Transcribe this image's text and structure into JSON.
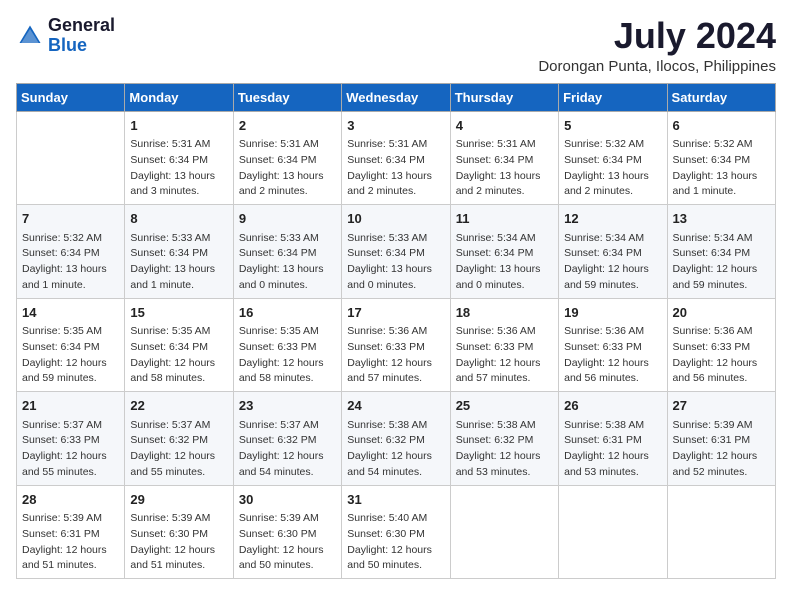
{
  "logo": {
    "general": "General",
    "blue": "Blue"
  },
  "title": {
    "month_year": "July 2024",
    "location": "Dorongan Punta, Ilocos, Philippines"
  },
  "headers": [
    "Sunday",
    "Monday",
    "Tuesday",
    "Wednesday",
    "Thursday",
    "Friday",
    "Saturday"
  ],
  "weeks": [
    [
      {
        "day": "",
        "info": ""
      },
      {
        "day": "1",
        "info": "Sunrise: 5:31 AM\nSunset: 6:34 PM\nDaylight: 13 hours\nand 3 minutes."
      },
      {
        "day": "2",
        "info": "Sunrise: 5:31 AM\nSunset: 6:34 PM\nDaylight: 13 hours\nand 2 minutes."
      },
      {
        "day": "3",
        "info": "Sunrise: 5:31 AM\nSunset: 6:34 PM\nDaylight: 13 hours\nand 2 minutes."
      },
      {
        "day": "4",
        "info": "Sunrise: 5:31 AM\nSunset: 6:34 PM\nDaylight: 13 hours\nand 2 minutes."
      },
      {
        "day": "5",
        "info": "Sunrise: 5:32 AM\nSunset: 6:34 PM\nDaylight: 13 hours\nand 2 minutes."
      },
      {
        "day": "6",
        "info": "Sunrise: 5:32 AM\nSunset: 6:34 PM\nDaylight: 13 hours\nand 1 minute."
      }
    ],
    [
      {
        "day": "7",
        "info": "Sunrise: 5:32 AM\nSunset: 6:34 PM\nDaylight: 13 hours\nand 1 minute."
      },
      {
        "day": "8",
        "info": "Sunrise: 5:33 AM\nSunset: 6:34 PM\nDaylight: 13 hours\nand 1 minute."
      },
      {
        "day": "9",
        "info": "Sunrise: 5:33 AM\nSunset: 6:34 PM\nDaylight: 13 hours\nand 0 minutes."
      },
      {
        "day": "10",
        "info": "Sunrise: 5:33 AM\nSunset: 6:34 PM\nDaylight: 13 hours\nand 0 minutes."
      },
      {
        "day": "11",
        "info": "Sunrise: 5:34 AM\nSunset: 6:34 PM\nDaylight: 13 hours\nand 0 minutes."
      },
      {
        "day": "12",
        "info": "Sunrise: 5:34 AM\nSunset: 6:34 PM\nDaylight: 12 hours\nand 59 minutes."
      },
      {
        "day": "13",
        "info": "Sunrise: 5:34 AM\nSunset: 6:34 PM\nDaylight: 12 hours\nand 59 minutes."
      }
    ],
    [
      {
        "day": "14",
        "info": "Sunrise: 5:35 AM\nSunset: 6:34 PM\nDaylight: 12 hours\nand 59 minutes."
      },
      {
        "day": "15",
        "info": "Sunrise: 5:35 AM\nSunset: 6:34 PM\nDaylight: 12 hours\nand 58 minutes."
      },
      {
        "day": "16",
        "info": "Sunrise: 5:35 AM\nSunset: 6:33 PM\nDaylight: 12 hours\nand 58 minutes."
      },
      {
        "day": "17",
        "info": "Sunrise: 5:36 AM\nSunset: 6:33 PM\nDaylight: 12 hours\nand 57 minutes."
      },
      {
        "day": "18",
        "info": "Sunrise: 5:36 AM\nSunset: 6:33 PM\nDaylight: 12 hours\nand 57 minutes."
      },
      {
        "day": "19",
        "info": "Sunrise: 5:36 AM\nSunset: 6:33 PM\nDaylight: 12 hours\nand 56 minutes."
      },
      {
        "day": "20",
        "info": "Sunrise: 5:36 AM\nSunset: 6:33 PM\nDaylight: 12 hours\nand 56 minutes."
      }
    ],
    [
      {
        "day": "21",
        "info": "Sunrise: 5:37 AM\nSunset: 6:33 PM\nDaylight: 12 hours\nand 55 minutes."
      },
      {
        "day": "22",
        "info": "Sunrise: 5:37 AM\nSunset: 6:32 PM\nDaylight: 12 hours\nand 55 minutes."
      },
      {
        "day": "23",
        "info": "Sunrise: 5:37 AM\nSunset: 6:32 PM\nDaylight: 12 hours\nand 54 minutes."
      },
      {
        "day": "24",
        "info": "Sunrise: 5:38 AM\nSunset: 6:32 PM\nDaylight: 12 hours\nand 54 minutes."
      },
      {
        "day": "25",
        "info": "Sunrise: 5:38 AM\nSunset: 6:32 PM\nDaylight: 12 hours\nand 53 minutes."
      },
      {
        "day": "26",
        "info": "Sunrise: 5:38 AM\nSunset: 6:31 PM\nDaylight: 12 hours\nand 53 minutes."
      },
      {
        "day": "27",
        "info": "Sunrise: 5:39 AM\nSunset: 6:31 PM\nDaylight: 12 hours\nand 52 minutes."
      }
    ],
    [
      {
        "day": "28",
        "info": "Sunrise: 5:39 AM\nSunset: 6:31 PM\nDaylight: 12 hours\nand 51 minutes."
      },
      {
        "day": "29",
        "info": "Sunrise: 5:39 AM\nSunset: 6:30 PM\nDaylight: 12 hours\nand 51 minutes."
      },
      {
        "day": "30",
        "info": "Sunrise: 5:39 AM\nSunset: 6:30 PM\nDaylight: 12 hours\nand 50 minutes."
      },
      {
        "day": "31",
        "info": "Sunrise: 5:40 AM\nSunset: 6:30 PM\nDaylight: 12 hours\nand 50 minutes."
      },
      {
        "day": "",
        "info": ""
      },
      {
        "day": "",
        "info": ""
      },
      {
        "day": "",
        "info": ""
      }
    ]
  ]
}
